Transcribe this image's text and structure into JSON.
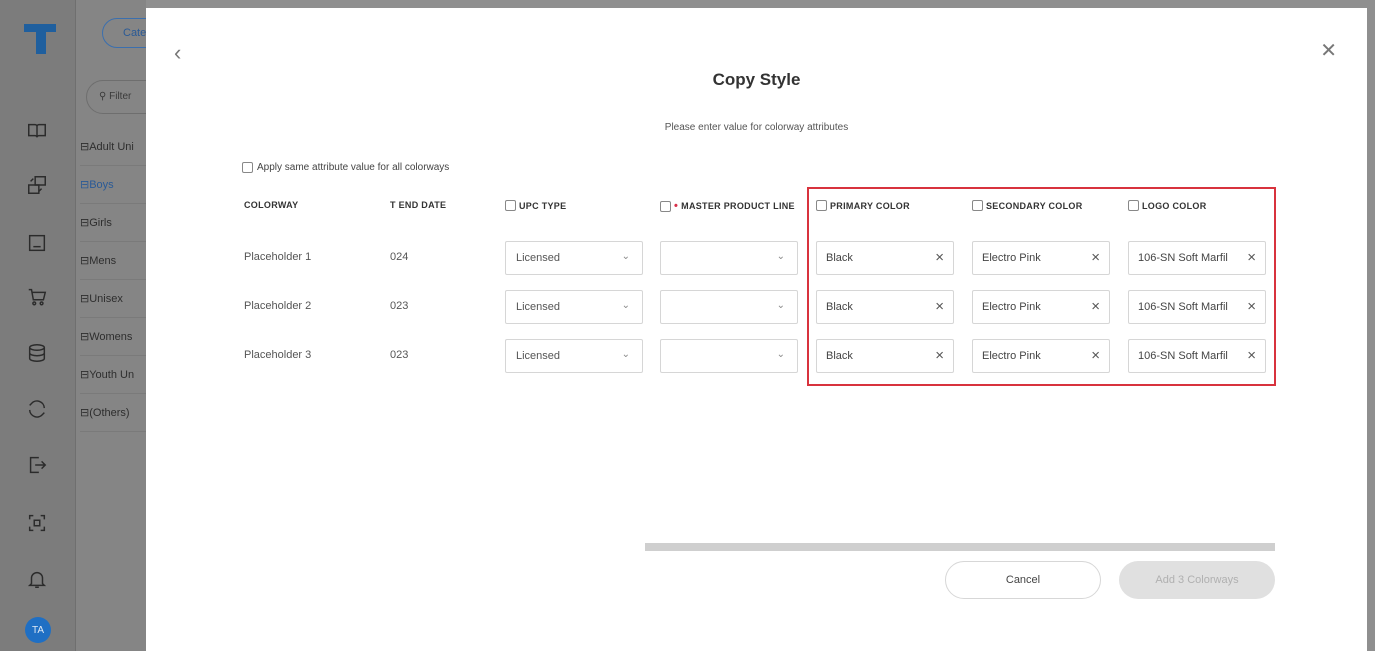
{
  "app": {
    "rail_icons": [
      "book-icon",
      "image-sync-icon",
      "monitor-icon",
      "cart-icon",
      "database-icon",
      "refresh-icon",
      "export-icon",
      "scan-icon",
      "bell-icon"
    ],
    "avatar_initials": "TA",
    "category_pill": "Categ",
    "filter_placeholder": "Filter",
    "tree": [
      "Adult Uni",
      "Boys",
      "Girls",
      "Mens",
      "Unisex",
      "Womens",
      "Youth Un",
      "(Others)"
    ],
    "brand_color": "#1f6fc4"
  },
  "modal": {
    "title": "Copy Style",
    "subtitle": "Please enter value for colorway attributes",
    "apply_all_label": "Apply same attribute value for all colorways",
    "columns": {
      "colorway": "COLORWAY",
      "end_date": "T END DATE",
      "upc_type": "UPC TYPE",
      "master_product_line": "MASTER PRODUCT LINE",
      "primary_color": "PRIMARY COLOR",
      "secondary_color": "SECONDARY COLOR",
      "logo_color": "LOGO COLOR"
    },
    "rows": [
      {
        "colorway": "Placeholder 1",
        "end_date": "024",
        "upc_type": "Licensed",
        "master_product_line": "",
        "primary_color": "Black",
        "secondary_color": "Electro Pink",
        "logo_color": "106-SN Soft Marfil"
      },
      {
        "colorway": "Placeholder 2",
        "end_date": "023",
        "upc_type": "Licensed",
        "master_product_line": "",
        "primary_color": "Black",
        "secondary_color": "Electro Pink",
        "logo_color": "106-SN Soft Marfil"
      },
      {
        "colorway": "Placeholder 3",
        "end_date": "023",
        "upc_type": "Licensed",
        "master_product_line": "",
        "primary_color": "Black",
        "secondary_color": "Electro Pink",
        "logo_color": "106-SN Soft Marfil"
      }
    ],
    "cancel_label": "Cancel",
    "add_label": "Add 3 Colorways",
    "highlight_color": "#d8333d",
    "required_color": "#d9304a"
  }
}
